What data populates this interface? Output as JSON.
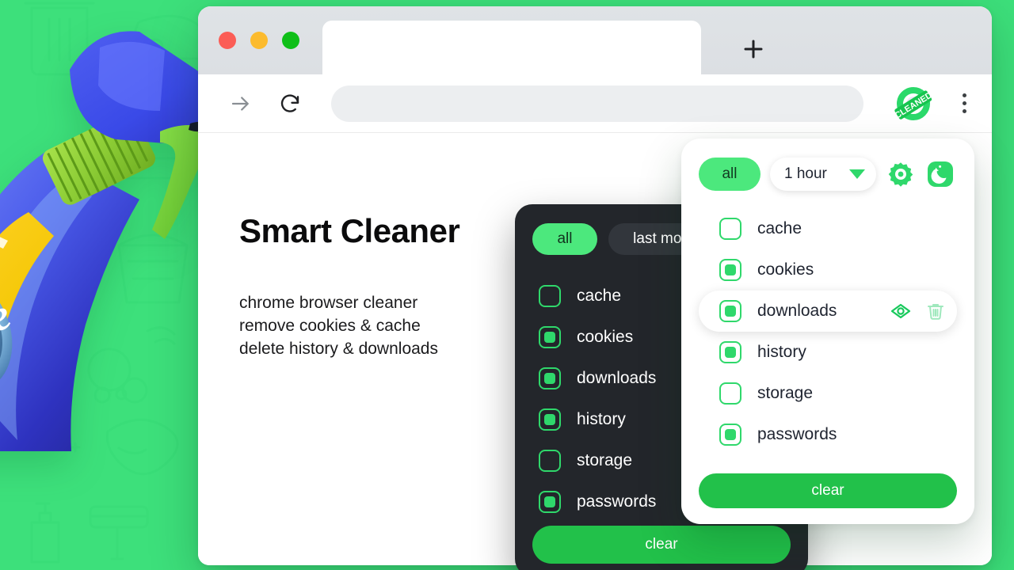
{
  "theme": {
    "background_green": "#3de07b",
    "accent_green": "#2fd86b",
    "button_green": "#22c14a",
    "chip_green": "#4ce87d",
    "dark_panel": "#23262b",
    "text_dark": "#1f2430"
  },
  "browser": {
    "window_controls": [
      {
        "name": "close",
        "color": "#fb5d56"
      },
      {
        "name": "minimize",
        "color": "#fcbb2e"
      },
      {
        "name": "maximize",
        "color": "#0fbf18"
      }
    ],
    "tab_title": "",
    "new_tab_label": "+",
    "toolbar": {
      "forward_icon": "arrow-right-icon",
      "reload_icon": "reload-icon",
      "address_value": "",
      "address_placeholder": "",
      "extension_badge": "CLEANED",
      "menu_icon": "kebab-menu-icon"
    }
  },
  "page": {
    "headline": "Smart Cleaner",
    "subcopy_lines": [
      "chrome browser cleaner",
      "remove cookies & cache",
      "delete history & downloads"
    ]
  },
  "dark_popup": {
    "scope_chip": "all",
    "period_chip": "last month",
    "items": [
      {
        "label": "cache",
        "checked": false
      },
      {
        "label": "cookies",
        "checked": true
      },
      {
        "label": "downloads",
        "checked": true
      },
      {
        "label": "history",
        "checked": true
      },
      {
        "label": "storage",
        "checked": false
      },
      {
        "label": "passwords",
        "checked": true
      }
    ],
    "clear_label": "clear"
  },
  "light_popup": {
    "scope_chip": "all",
    "period_value": "1 hour",
    "settings_icon": "gear-icon",
    "nightmode_icon": "moon-icon",
    "items": [
      {
        "label": "cache",
        "checked": false,
        "active": false
      },
      {
        "label": "cookies",
        "checked": true,
        "active": false
      },
      {
        "label": "downloads",
        "checked": true,
        "active": true,
        "actions": [
          "eye-icon",
          "trash-icon"
        ]
      },
      {
        "label": "history",
        "checked": true,
        "active": false
      },
      {
        "label": "storage",
        "checked": false,
        "active": false
      },
      {
        "label": "passwords",
        "checked": true,
        "active": false
      }
    ],
    "clear_label": "clear"
  },
  "artwork": {
    "product_label_text": "dge",
    "product_sub_text": "er"
  }
}
